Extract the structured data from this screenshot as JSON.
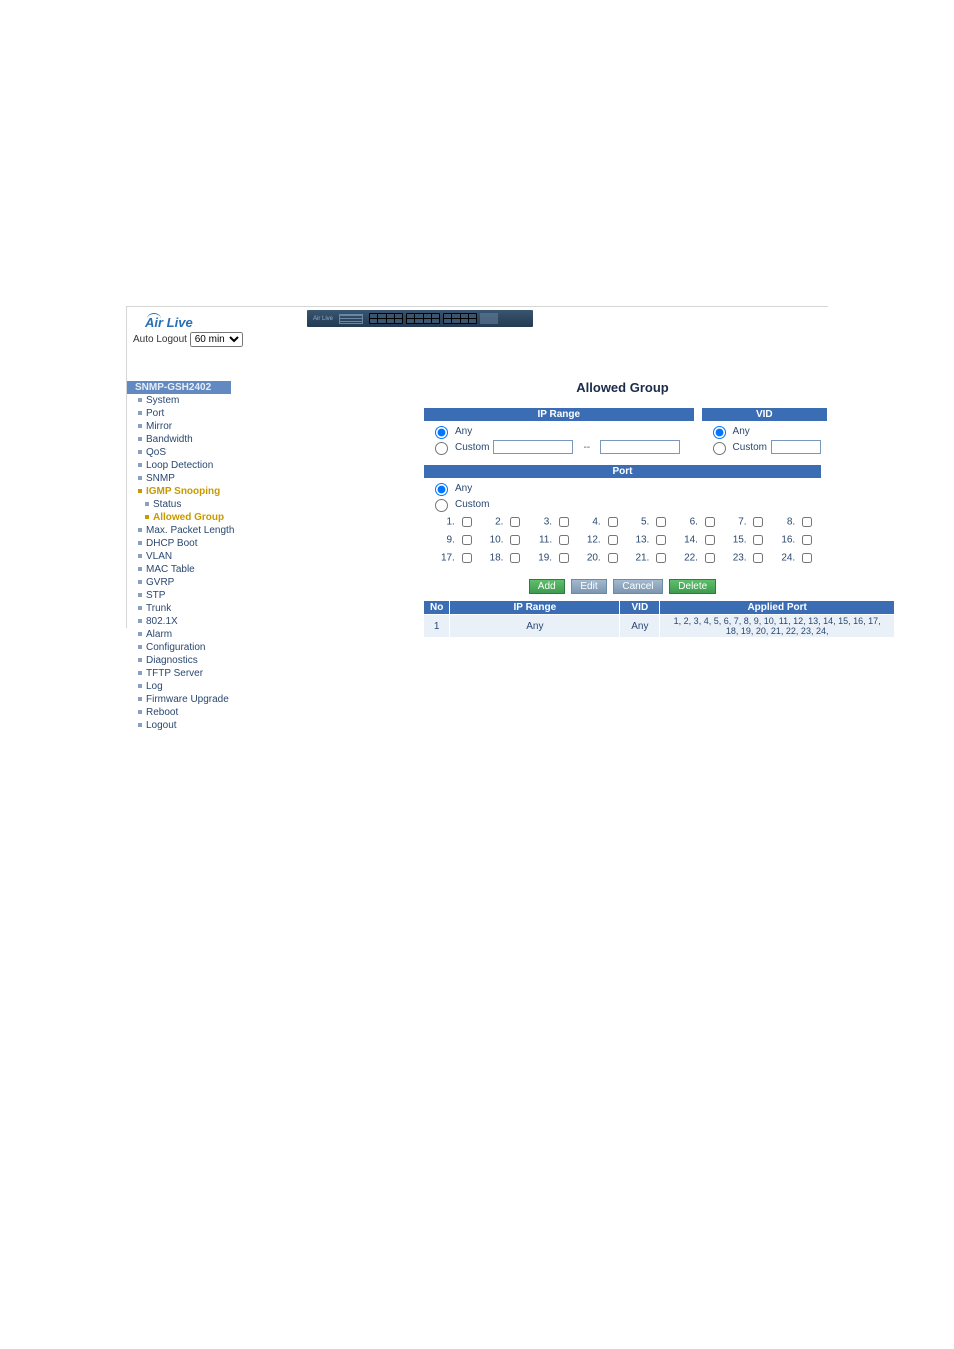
{
  "brand": "Air Live",
  "autologout": {
    "label": "Auto Logout",
    "value": "60 min"
  },
  "device_model": "SNMP-GSH2402",
  "main_title": "Allowed Group",
  "sections": {
    "ip_range": "IP Range",
    "vid": "VID",
    "port": "Port"
  },
  "opts": {
    "any": "Any",
    "custom": "Custom"
  },
  "ip_sep": "--",
  "buttons": {
    "add": "Add",
    "edit": "Edit",
    "cancel": "Cancel",
    "del": "Delete"
  },
  "table": {
    "headers": {
      "no": "No",
      "ip_range": "IP Range",
      "vid": "VID",
      "port": "Applied Port"
    },
    "rows": [
      {
        "no": "1",
        "ip_range": "Any",
        "vid": "Any",
        "ports": "1, 2, 3, 4, 5, 6, 7, 8, 9, 10, 11, 12, 13, 14, 15, 16, 17, 18, 19, 20, 21, 22, 23, 24,"
      }
    ]
  },
  "menu": [
    {
      "l": "System",
      "sub": false
    },
    {
      "l": "Port",
      "sub": false
    },
    {
      "l": "Mirror",
      "sub": false
    },
    {
      "l": "Bandwidth",
      "sub": false
    },
    {
      "l": "QoS",
      "sub": false
    },
    {
      "l": "Loop Detection",
      "sub": false
    },
    {
      "l": "SNMP",
      "sub": false
    },
    {
      "l": "IGMP Snooping",
      "sub": false,
      "active": true
    },
    {
      "l": "Status",
      "sub": true
    },
    {
      "l": "Allowed Group",
      "sub": true,
      "active": true
    },
    {
      "l": "Max. Packet Length",
      "sub": false
    },
    {
      "l": "DHCP Boot",
      "sub": false
    },
    {
      "l": "VLAN",
      "sub": false
    },
    {
      "l": "MAC Table",
      "sub": false
    },
    {
      "l": "GVRP",
      "sub": false
    },
    {
      "l": "STP",
      "sub": false
    },
    {
      "l": "Trunk",
      "sub": false
    },
    {
      "l": "802.1X",
      "sub": false
    },
    {
      "l": "Alarm",
      "sub": false
    },
    {
      "l": "Configuration",
      "sub": false
    },
    {
      "l": "Diagnostics",
      "sub": false
    },
    {
      "l": "TFTP Server",
      "sub": false
    },
    {
      "l": "Log",
      "sub": false
    },
    {
      "l": "Firmware Upgrade",
      "sub": false
    },
    {
      "l": "Reboot",
      "sub": false
    },
    {
      "l": "Logout",
      "sub": false
    }
  ],
  "ports": [
    "1",
    "2",
    "3",
    "4",
    "5",
    "6",
    "7",
    "8",
    "9",
    "10",
    "11",
    "12",
    "13",
    "14",
    "15",
    "16",
    "17",
    "18",
    "19",
    "20",
    "21",
    "22",
    "23",
    "24"
  ]
}
